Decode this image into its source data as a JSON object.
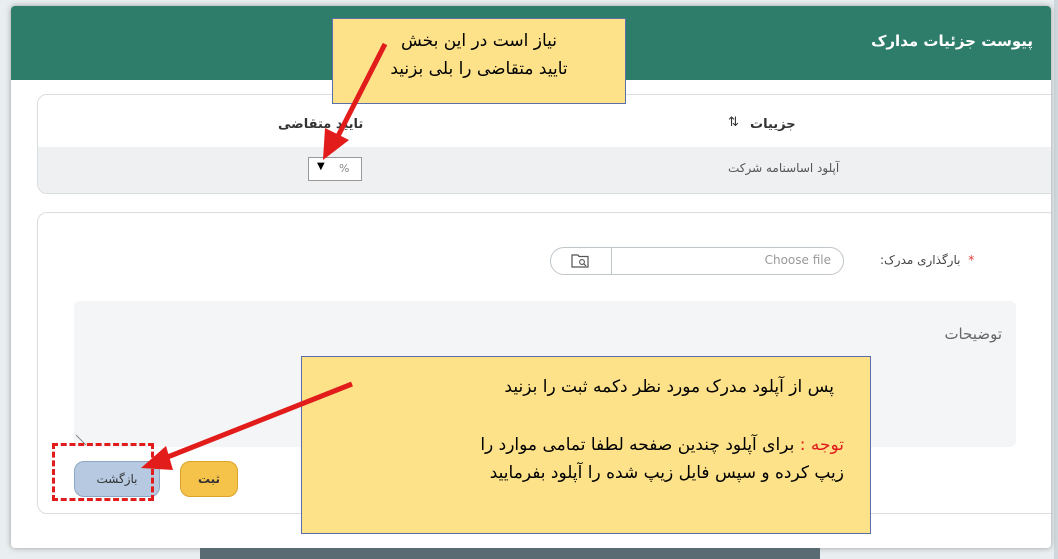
{
  "modal": {
    "title": "پیوست جزئیات مدارک"
  },
  "table": {
    "col_details": "جزییات",
    "col_confirm": "تایید متقاضی",
    "row_document": "آپلود اساسنامه شرکت",
    "select_value": "%"
  },
  "form": {
    "upload_label": "بارگذاری مدرک:",
    "file_placeholder": "Choose file",
    "description_placeholder": "توضیحات",
    "save_label": "ثبت",
    "back_label": "بازگشت"
  },
  "callouts": {
    "top_line1": "نیاز است در این بخش",
    "top_line2": "تایید متقاضی را بلی بزنید",
    "bottom_line1": "پس از آپلود مدرک مورد نظر دکمه ثبت را بزنید",
    "bottom_note_prefix": "توجه :",
    "bottom_note_line1": " برای آپلود چندین صفحه لطفا تمامی موارد را",
    "bottom_note_line2": "زیپ کرده و سپس فایل زیپ شده را آپلود بفرمایید"
  },
  "colors": {
    "header": "#2e7d6b",
    "callout_bg": "#fde28a",
    "arrow": "#e21b1b",
    "save_button": "#f5c24a",
    "back_button": "#b6c9e0"
  },
  "icons": {
    "sort": "sort-arrow-icon",
    "folder": "folder-search-icon",
    "select_caret": "caret-down-icon"
  }
}
